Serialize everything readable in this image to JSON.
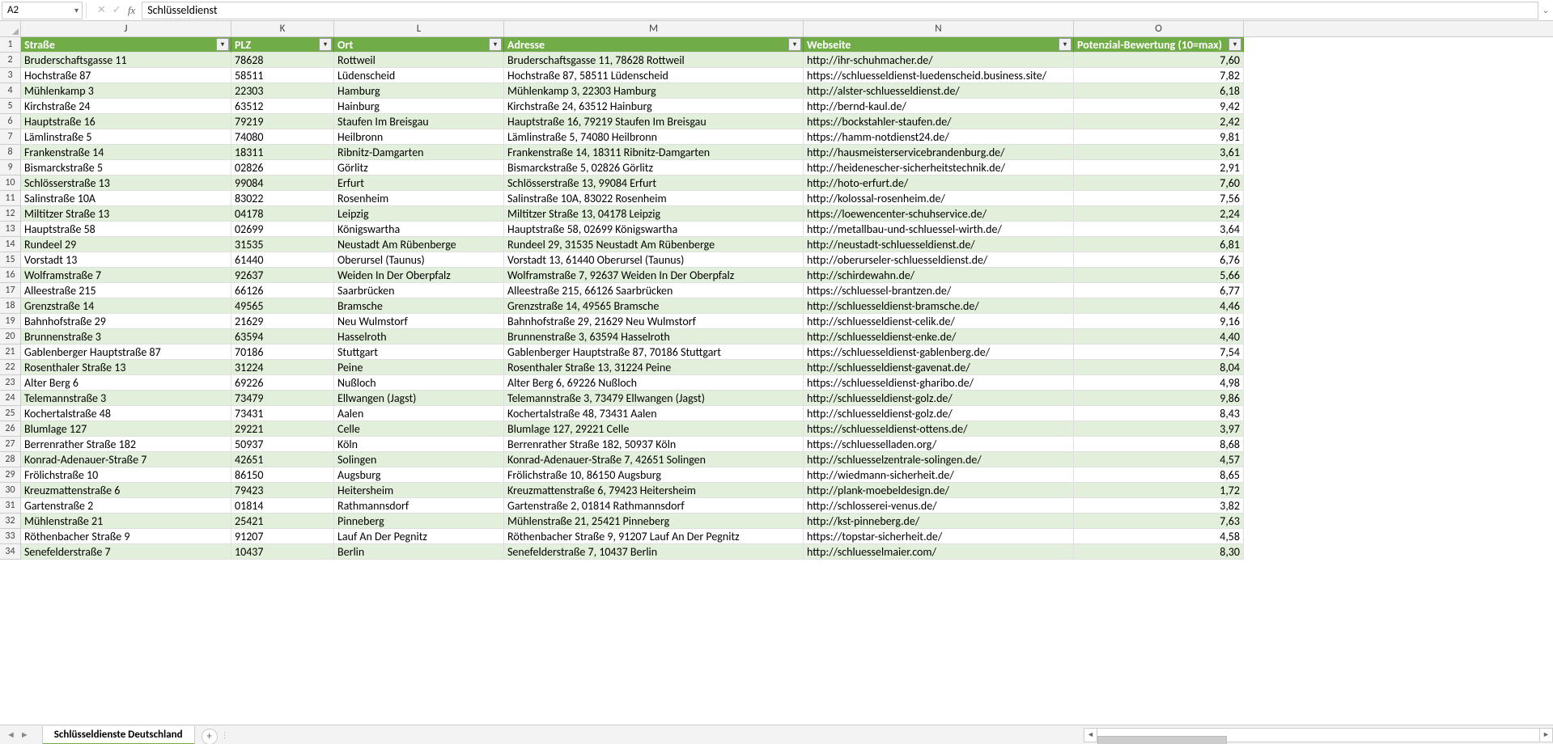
{
  "formula_bar": {
    "name_box": "A2",
    "formula": "Schlüsseldienst"
  },
  "columns": [
    {
      "letter": "J",
      "key": "strasse",
      "label": "Straße",
      "cls": "c-j"
    },
    {
      "letter": "K",
      "key": "plz",
      "label": "PLZ",
      "cls": "c-k"
    },
    {
      "letter": "L",
      "key": "ort",
      "label": "Ort",
      "cls": "c-l"
    },
    {
      "letter": "M",
      "key": "adresse",
      "label": "Adresse",
      "cls": "c-m"
    },
    {
      "letter": "N",
      "key": "webseite",
      "label": "Webseite",
      "cls": "c-n"
    },
    {
      "letter": "O",
      "key": "potenzial",
      "label": "Potenzial-Bewertung (10=max)",
      "cls": "c-o"
    }
  ],
  "rows": [
    {
      "n": 2,
      "strasse": "Bruderschaftsgasse 11",
      "plz": "78628",
      "ort": "Rottweil",
      "adresse": "Bruderschaftsgasse 11, 78628 Rottweil",
      "webseite": "http://ihr-schuhmacher.de/",
      "potenzial": "7,60"
    },
    {
      "n": 3,
      "strasse": "Hochstraße 87",
      "plz": "58511",
      "ort": "Lüdenscheid",
      "adresse": "Hochstraße 87, 58511 Lüdenscheid",
      "webseite": "https://schluesseldienst-luedenscheid.business.site/",
      "potenzial": "7,82"
    },
    {
      "n": 4,
      "strasse": "Mühlenkamp 3",
      "plz": "22303",
      "ort": "Hamburg",
      "adresse": "Mühlenkamp 3, 22303 Hamburg",
      "webseite": "http://alster-schluesseldienst.de/",
      "potenzial": "6,18"
    },
    {
      "n": 5,
      "strasse": "Kirchstraße 24",
      "plz": "63512",
      "ort": "Hainburg",
      "adresse": "Kirchstraße 24, 63512 Hainburg",
      "webseite": "http://bernd-kaul.de/",
      "potenzial": "9,42"
    },
    {
      "n": 6,
      "strasse": "Hauptstraße 16",
      "plz": "79219",
      "ort": "Staufen Im Breisgau",
      "adresse": "Hauptstraße 16, 79219 Staufen Im Breisgau",
      "webseite": "https://bockstahler-staufen.de/",
      "potenzial": "2,42"
    },
    {
      "n": 7,
      "strasse": "Lämlinstraße 5",
      "plz": "74080",
      "ort": "Heilbronn",
      "adresse": "Lämlinstraße 5, 74080 Heilbronn",
      "webseite": "https://hamm-notdienst24.de/",
      "potenzial": "9,81"
    },
    {
      "n": 8,
      "strasse": "Frankenstraße 14",
      "plz": "18311",
      "ort": "Ribnitz-Damgarten",
      "adresse": "Frankenstraße 14, 18311 Ribnitz-Damgarten",
      "webseite": "http://hausmeisterservicebrandenburg.de/",
      "potenzial": "3,61"
    },
    {
      "n": 9,
      "strasse": "Bismarckstraße 5",
      "plz": "02826",
      "ort": "Görlitz",
      "adresse": "Bismarckstraße 5, 02826 Görlitz",
      "webseite": "http://heidenescher-sicherheitstechnik.de/",
      "potenzial": "2,91"
    },
    {
      "n": 10,
      "strasse": "Schlösserstraße 13",
      "plz": "99084",
      "ort": "Erfurt",
      "adresse": "Schlösserstraße 13, 99084 Erfurt",
      "webseite": "http://hoto-erfurt.de/",
      "potenzial": "7,60"
    },
    {
      "n": 11,
      "strasse": "Salinstraße 10A",
      "plz": "83022",
      "ort": "Rosenheim",
      "adresse": "Salinstraße 10A, 83022 Rosenheim",
      "webseite": "http://kolossal-rosenheim.de/",
      "potenzial": "7,56"
    },
    {
      "n": 12,
      "strasse": "Miltitzer Straße 13",
      "plz": "04178",
      "ort": "Leipzig",
      "adresse": "Miltitzer Straße 13, 04178 Leipzig",
      "webseite": "https://loewencenter-schuhservice.de/",
      "potenzial": "2,24"
    },
    {
      "n": 13,
      "strasse": "Hauptstraße 58",
      "plz": "02699",
      "ort": "Königswartha",
      "adresse": "Hauptstraße 58, 02699 Königswartha",
      "webseite": "http://metallbau-und-schluessel-wirth.de/",
      "potenzial": "3,64"
    },
    {
      "n": 14,
      "strasse": "Rundeel 29",
      "plz": "31535",
      "ort": "Neustadt Am Rübenberge",
      "adresse": "Rundeel 29, 31535 Neustadt Am Rübenberge",
      "webseite": "http://neustadt-schluesseldienst.de/",
      "potenzial": "6,81"
    },
    {
      "n": 15,
      "strasse": "Vorstadt 13",
      "plz": "61440",
      "ort": "Oberursel (Taunus)",
      "adresse": "Vorstadt 13, 61440 Oberursel (Taunus)",
      "webseite": "http://oberurseler-schluesseldienst.de/",
      "potenzial": "6,76"
    },
    {
      "n": 16,
      "strasse": "Wolframstraße 7",
      "plz": "92637",
      "ort": "Weiden In Der Oberpfalz",
      "adresse": "Wolframstraße 7, 92637 Weiden In Der Oberpfalz",
      "webseite": "http://schirdewahn.de/",
      "potenzial": "5,66"
    },
    {
      "n": 17,
      "strasse": "Alleestraße 215",
      "plz": "66126",
      "ort": "Saarbrücken",
      "adresse": "Alleestraße 215, 66126 Saarbrücken",
      "webseite": "https://schluessel-brantzen.de/",
      "potenzial": "6,77"
    },
    {
      "n": 18,
      "strasse": "Grenzstraße 14",
      "plz": "49565",
      "ort": "Bramsche",
      "adresse": "Grenzstraße 14, 49565 Bramsche",
      "webseite": "http://schluesseldienst-bramsche.de/",
      "potenzial": "4,46"
    },
    {
      "n": 19,
      "strasse": "Bahnhofstraße 29",
      "plz": "21629",
      "ort": "Neu Wulmstorf",
      "adresse": "Bahnhofstraße 29, 21629 Neu Wulmstorf",
      "webseite": "http://schluesseldienst-celik.de/",
      "potenzial": "9,16"
    },
    {
      "n": 20,
      "strasse": "Brunnenstraße 3",
      "plz": "63594",
      "ort": "Hasselroth",
      "adresse": "Brunnenstraße 3, 63594 Hasselroth",
      "webseite": "http://schluesseldienst-enke.de/",
      "potenzial": "4,40"
    },
    {
      "n": 21,
      "strasse": "Gablenberger Hauptstraße 87",
      "plz": "70186",
      "ort": "Stuttgart",
      "adresse": "Gablenberger Hauptstraße 87, 70186 Stuttgart",
      "webseite": "https://schluesseldienst-gablenberg.de/",
      "potenzial": "7,54"
    },
    {
      "n": 22,
      "strasse": "Rosenthaler Straße 13",
      "plz": "31224",
      "ort": "Peine",
      "adresse": "Rosenthaler Straße 13, 31224 Peine",
      "webseite": "http://schluesseldienst-gavenat.de/",
      "potenzial": "8,04"
    },
    {
      "n": 23,
      "strasse": "Alter Berg 6",
      "plz": "69226",
      "ort": "Nußloch",
      "adresse": "Alter Berg 6, 69226 Nußloch",
      "webseite": "https://schluesseldienst-gharibo.de/",
      "potenzial": "4,98"
    },
    {
      "n": 24,
      "strasse": "Telemannstraße 3",
      "plz": "73479",
      "ort": "Ellwangen (Jagst)",
      "adresse": "Telemannstraße 3, 73479 Ellwangen (Jagst)",
      "webseite": "http://schluesseldienst-golz.de/",
      "potenzial": "9,86"
    },
    {
      "n": 25,
      "strasse": "Kochertalstraße 48",
      "plz": "73431",
      "ort": "Aalen",
      "adresse": "Kochertalstraße 48, 73431 Aalen",
      "webseite": "http://schluesseldienst-golz.de/",
      "potenzial": "8,43"
    },
    {
      "n": 26,
      "strasse": "Blumlage 127",
      "plz": "29221",
      "ort": "Celle",
      "adresse": "Blumlage 127, 29221 Celle",
      "webseite": "https://schluesseldienst-ottens.de/",
      "potenzial": "3,97"
    },
    {
      "n": 27,
      "strasse": "Berrenrather Straße 182",
      "plz": "50937",
      "ort": "Köln",
      "adresse": "Berrenrather Straße 182, 50937 Köln",
      "webseite": "https://schluesselladen.org/",
      "potenzial": "8,68"
    },
    {
      "n": 28,
      "strasse": "Konrad-Adenauer-Straße 7",
      "plz": "42651",
      "ort": "Solingen",
      "adresse": "Konrad-Adenauer-Straße 7, 42651 Solingen",
      "webseite": "http://schluesselzentrale-solingen.de/",
      "potenzial": "4,57"
    },
    {
      "n": 29,
      "strasse": "Frölichstraße 10",
      "plz": "86150",
      "ort": "Augsburg",
      "adresse": "Frölichstraße 10, 86150 Augsburg",
      "webseite": "http://wiedmann-sicherheit.de/",
      "potenzial": "8,65"
    },
    {
      "n": 30,
      "strasse": "Kreuzmattenstraße 6",
      "plz": "79423",
      "ort": "Heitersheim",
      "adresse": "Kreuzmattenstraße 6, 79423 Heitersheim",
      "webseite": "http://plank-moebeldesign.de/",
      "potenzial": "1,72"
    },
    {
      "n": 31,
      "strasse": "Gartenstraße 2",
      "plz": "01814",
      "ort": "Rathmannsdorf",
      "adresse": "Gartenstraße 2, 01814 Rathmannsdorf",
      "webseite": "http://schlosserei-venus.de/",
      "potenzial": "3,82"
    },
    {
      "n": 32,
      "strasse": "Mühlenstraße 21",
      "plz": "25421",
      "ort": "Pinneberg",
      "adresse": "Mühlenstraße 21, 25421 Pinneberg",
      "webseite": "http://kst-pinneberg.de/",
      "potenzial": "7,63"
    },
    {
      "n": 33,
      "strasse": "Röthenbacher Straße 9",
      "plz": "91207",
      "ort": "Lauf An Der Pegnitz",
      "adresse": "Röthenbacher Straße 9, 91207 Lauf An Der Pegnitz",
      "webseite": "https://topstar-sicherheit.de/",
      "potenzial": "4,58"
    },
    {
      "n": 34,
      "strasse": "Senefelderstraße 7",
      "plz": "10437",
      "ort": "Berlin",
      "adresse": "Senefelderstraße 7, 10437 Berlin",
      "webseite": "http://schluesselmaier.com/",
      "potenzial": "8,30"
    }
  ],
  "sheet": {
    "active_tab": "Schlüsseldienste Deutschland"
  }
}
